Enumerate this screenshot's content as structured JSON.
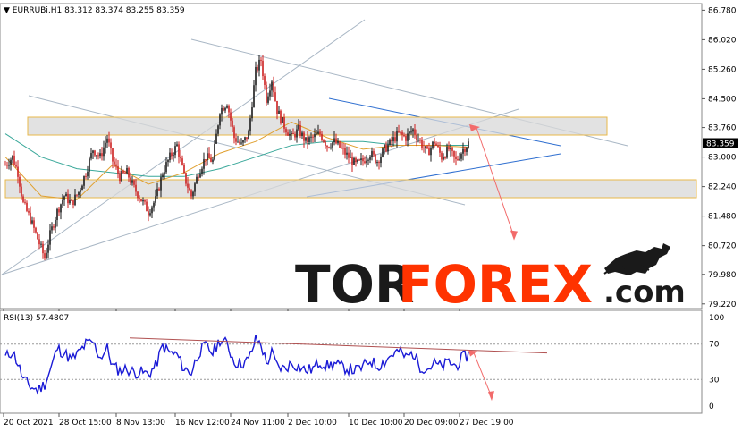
{
  "chart_data": {
    "type": "candlestick",
    "symbol_header": "EURRUBi,H1",
    "ohlc_header": "83.312 83.374 83.255 83.359",
    "current_price": "83.359",
    "current_value": 83.359,
    "y_range": [
      79.1,
      86.95
    ],
    "y_ticks": [
      {
        "label": "86.780",
        "value": 86.78
      },
      {
        "label": "86.020",
        "value": 86.02
      },
      {
        "label": "85.260",
        "value": 85.26
      },
      {
        "label": "84.500",
        "value": 84.5
      },
      {
        "label": "83.760",
        "value": 83.76
      },
      {
        "label": "83.000",
        "value": 83.0
      },
      {
        "label": "82.240",
        "value": 82.24
      },
      {
        "label": "81.480",
        "value": 81.48
      },
      {
        "label": "80.720",
        "value": 80.72
      },
      {
        "label": "79.980",
        "value": 79.98
      },
      {
        "label": "79.220",
        "value": 79.22
      }
    ],
    "x_ticks": [
      "20 Oct 2021",
      "28 Oct 15:00",
      "8 Nov 13:00",
      "16 Nov 12:00",
      "24 Nov 11:00",
      "2 Dec 10:00",
      "10 Dec 10:00",
      "20 Dec 09:00",
      "27 Dec 19:00"
    ],
    "price_path": [
      [
        0,
        82.8
      ],
      [
        8,
        83.0
      ],
      [
        14,
        82.6
      ],
      [
        20,
        81.8
      ],
      [
        28,
        81.4
      ],
      [
        36,
        80.9
      ],
      [
        44,
        80.4
      ],
      [
        50,
        81.0
      ],
      [
        58,
        81.6
      ],
      [
        66,
        82.0
      ],
      [
        74,
        81.8
      ],
      [
        82,
        82.1
      ],
      [
        90,
        82.6
      ],
      [
        98,
        83.2
      ],
      [
        106,
        83.0
      ],
      [
        114,
        83.5
      ],
      [
        120,
        82.9
      ],
      [
        128,
        82.5
      ],
      [
        136,
        82.6
      ],
      [
        144,
        82.2
      ],
      [
        152,
        81.9
      ],
      [
        160,
        81.6
      ],
      [
        168,
        81.9
      ],
      [
        176,
        82.6
      ],
      [
        184,
        83.0
      ],
      [
        192,
        83.3
      ],
      [
        200,
        82.5
      ],
      [
        208,
        82.0
      ],
      [
        216,
        82.6
      ],
      [
        224,
        83.0
      ],
      [
        232,
        82.9
      ],
      [
        240,
        84.2
      ],
      [
        248,
        84.4
      ],
      [
        256,
        83.5
      ],
      [
        264,
        83.3
      ],
      [
        272,
        83.6
      ],
      [
        280,
        85.2
      ],
      [
        286,
        85.5
      ],
      [
        292,
        84.5
      ],
      [
        298,
        85.0
      ],
      [
        304,
        84.2
      ],
      [
        312,
        83.8
      ],
      [
        320,
        83.5
      ],
      [
        328,
        83.7
      ],
      [
        336,
        83.4
      ],
      [
        344,
        83.5
      ],
      [
        352,
        83.6
      ],
      [
        360,
        83.3
      ],
      [
        368,
        83.4
      ],
      [
        376,
        83.2
      ],
      [
        384,
        83.0
      ],
      [
        392,
        82.8
      ],
      [
        400,
        82.9
      ],
      [
        408,
        83.1
      ],
      [
        416,
        82.9
      ],
      [
        424,
        83.2
      ],
      [
        432,
        83.4
      ],
      [
        440,
        83.6
      ],
      [
        448,
        83.5
      ],
      [
        456,
        83.7
      ],
      [
        464,
        83.4
      ],
      [
        472,
        83.1
      ],
      [
        480,
        83.4
      ],
      [
        488,
        83.0
      ],
      [
        496,
        83.2
      ],
      [
        504,
        82.9
      ],
      [
        512,
        83.2
      ],
      [
        518,
        83.36
      ]
    ],
    "ma_fast": [
      [
        0,
        83.0
      ],
      [
        40,
        82.0
      ],
      [
        80,
        81.9
      ],
      [
        120,
        82.8
      ],
      [
        160,
        82.3
      ],
      [
        200,
        82.6
      ],
      [
        240,
        83.1
      ],
      [
        280,
        83.4
      ],
      [
        320,
        83.9
      ],
      [
        360,
        83.5
      ],
      [
        400,
        83.2
      ],
      [
        440,
        83.3
      ],
      [
        480,
        83.3
      ],
      [
        518,
        83.25
      ]
    ],
    "ma_slow": [
      [
        0,
        83.6
      ],
      [
        40,
        83.0
      ],
      [
        80,
        82.7
      ],
      [
        120,
        82.6
      ],
      [
        160,
        82.5
      ],
      [
        200,
        82.5
      ],
      [
        240,
        82.7
      ],
      [
        280,
        83.0
      ],
      [
        320,
        83.3
      ],
      [
        360,
        83.4
      ],
      [
        400,
        83.4
      ],
      [
        440,
        83.3
      ],
      [
        480,
        83.3
      ],
      [
        518,
        83.3
      ]
    ],
    "resistance_zone": [
      83.55,
      83.95
    ],
    "support_zone": [
      82.05,
      82.45
    ],
    "forecast_path": [
      [
        533,
        83.75
      ],
      [
        575,
        80.95
      ]
    ],
    "rsi": {
      "label": "RSI(13) 57.4807",
      "y_range": [
        0,
        100
      ],
      "y_ticks": [
        {
          "label": "100",
          "value": 100
        },
        {
          "label": "70",
          "value": 70
        },
        {
          "label": "30",
          "value": 30
        },
        {
          "label": "0",
          "value": 0
        }
      ],
      "path": [
        [
          0,
          55
        ],
        [
          8,
          62
        ],
        [
          14,
          48
        ],
        [
          20,
          30
        ],
        [
          28,
          22
        ],
        [
          36,
          18
        ],
        [
          44,
          25
        ],
        [
          50,
          40
        ],
        [
          58,
          65
        ],
        [
          66,
          60
        ],
        [
          74,
          52
        ],
        [
          82,
          60
        ],
        [
          90,
          70
        ],
        [
          98,
          72
        ],
        [
          106,
          55
        ],
        [
          114,
          65
        ],
        [
          120,
          45
        ],
        [
          128,
          40
        ],
        [
          136,
          42
        ],
        [
          144,
          38
        ],
        [
          152,
          38
        ],
        [
          160,
          36
        ],
        [
          168,
          45
        ],
        [
          176,
          68
        ],
        [
          184,
          60
        ],
        [
          192,
          58
        ],
        [
          200,
          42
        ],
        [
          208,
          38
        ],
        [
          216,
          60
        ],
        [
          224,
          68
        ],
        [
          232,
          60
        ],
        [
          240,
          75
        ],
        [
          248,
          70
        ],
        [
          256,
          50
        ],
        [
          264,
          48
        ],
        [
          272,
          52
        ],
        [
          280,
          75
        ],
        [
          286,
          70
        ],
        [
          292,
          48
        ],
        [
          298,
          60
        ],
        [
          304,
          45
        ],
        [
          312,
          42
        ],
        [
          320,
          48
        ],
        [
          328,
          45
        ],
        [
          336,
          40
        ],
        [
          344,
          42
        ],
        [
          352,
          50
        ],
        [
          360,
          45
        ],
        [
          368,
          48
        ],
        [
          376,
          44
        ],
        [
          384,
          42
        ],
        [
          392,
          40
        ],
        [
          400,
          44
        ],
        [
          408,
          52
        ],
        [
          416,
          45
        ],
        [
          424,
          50
        ],
        [
          432,
          58
        ],
        [
          440,
          62
        ],
        [
          448,
          55
        ],
        [
          456,
          60
        ],
        [
          464,
          45
        ],
        [
          472,
          42
        ],
        [
          480,
          48
        ],
        [
          488,
          44
        ],
        [
          496,
          50
        ],
        [
          504,
          45
        ],
        [
          512,
          55
        ],
        [
          518,
          57.5
        ]
      ],
      "resistance_line": [
        [
          145,
          77
        ],
        [
          612,
          60
        ]
      ],
      "forecast_path": [
        [
          530,
          60
        ],
        [
          550,
          10
        ]
      ]
    }
  },
  "logo": {
    "part1": "TOR",
    "part2": "FOREX",
    "part3": ".com"
  },
  "colors": {
    "bull": "#1a1a1a",
    "bear": "#cc1f1f",
    "rsi": "#1a1ad6",
    "zone": "#d8d8d8",
    "zone_border": "#e8b84a",
    "forecast": "#f26b6b"
  }
}
